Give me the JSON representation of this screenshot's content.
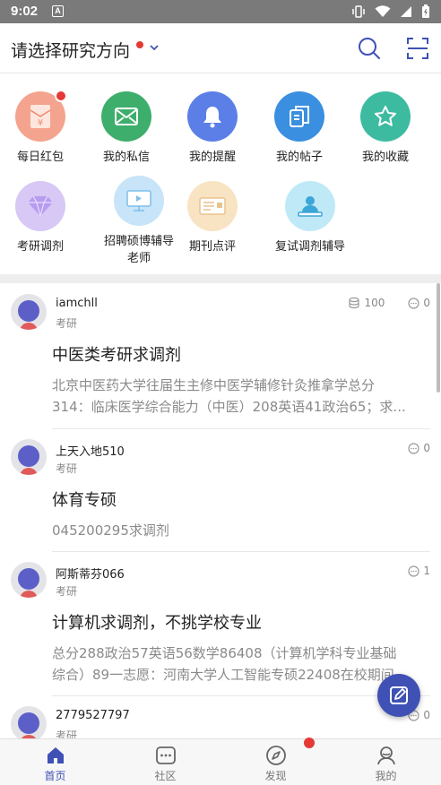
{
  "status_bar": {
    "time": "9:02",
    "notif_glyph": "A"
  },
  "header": {
    "title": "请选择研究方向"
  },
  "quick_actions": [
    {
      "label": "每日红包",
      "icon": "red-envelope-icon",
      "color": "#f4a38f"
    },
    {
      "label": "我的私信",
      "icon": "mail-icon",
      "color": "#3dae6b"
    },
    {
      "label": "我的提醒",
      "icon": "bell-icon",
      "color": "#5b7fe6"
    },
    {
      "label": "我的帖子",
      "icon": "document-icon",
      "color": "#3a8fe0"
    },
    {
      "label": "我的收藏",
      "icon": "star-icon",
      "color": "#3dbba0"
    },
    {
      "label": "考研调剂",
      "icon": "diamond-icon",
      "color": "#d8c8f5"
    },
    {
      "label": "招聘硕博辅导老师",
      "label_line1": "招聘硕博辅导",
      "label_line2": "老师",
      "icon": "monitor-icon",
      "color": "#c7e4f8"
    },
    {
      "label": "期刊点评",
      "icon": "journal-icon",
      "color": "#f8e3c2"
    },
    {
      "label": "复试调剂辅导",
      "icon": "tutor-icon",
      "color": "#bfe9f7"
    }
  ],
  "posts": [
    {
      "username": "iamchll",
      "category": "考研",
      "coins": "100",
      "comments": "0",
      "title": "中医类考研求调剂",
      "excerpt_line1": "北京中医药大学往届生主修中医学辅修针灸推拿学总分",
      "excerpt_line2": "314：临床医学综合能力（中医）208英语41政治65；求..."
    },
    {
      "username": "上天入地510",
      "category": "考研",
      "comments": "0",
      "title": "体育专硕",
      "excerpt_line1": "045200295求调剂"
    },
    {
      "username": "阿斯蒂芬066",
      "category": "考研",
      "comments": "1",
      "title": "计算机求调剂，不挑学校专业",
      "excerpt_line1": "总分288政治57英语56数学86408（计算机学科专业基础",
      "excerpt_line2": "综合）89一志愿：河南大学人工智能专硕22408在校期间..."
    },
    {
      "username": "2779527797",
      "category": "考研",
      "comments": "0"
    }
  ],
  "bottom_nav": [
    {
      "label": "首页",
      "icon": "home-icon",
      "active": true
    },
    {
      "label": "社区",
      "icon": "community-icon",
      "active": false
    },
    {
      "label": "发现",
      "icon": "compass-icon",
      "active": false
    },
    {
      "label": "我的",
      "icon": "profile-icon",
      "active": false
    }
  ],
  "colors": {
    "accent": "#3f51b5",
    "badge": "#e53935",
    "text": "#222222",
    "muted": "#888888"
  }
}
